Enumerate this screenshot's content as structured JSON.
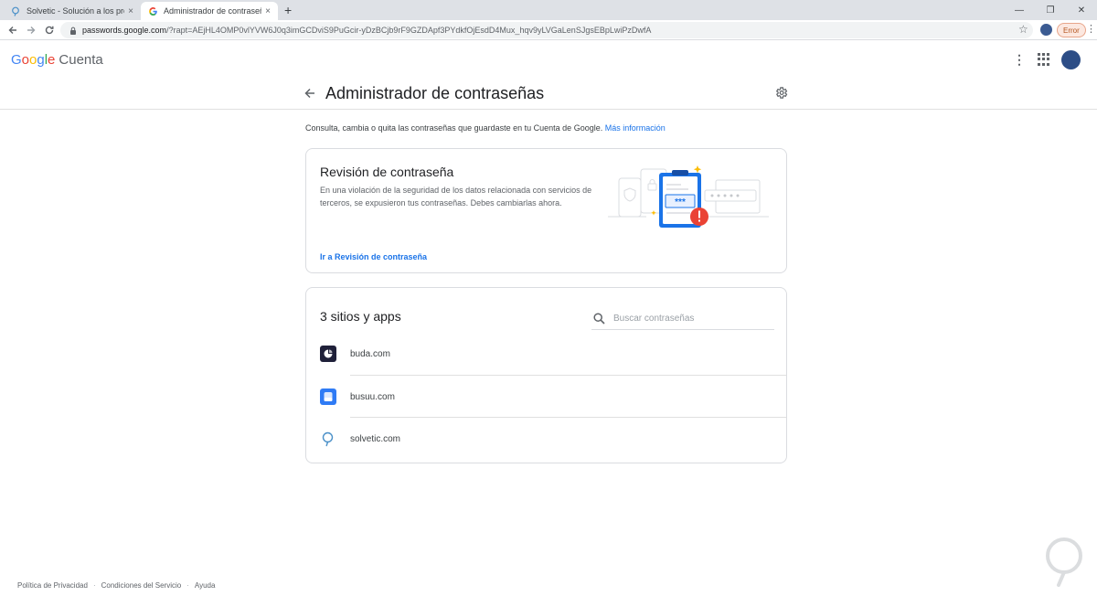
{
  "browser": {
    "tabs": [
      {
        "title": "Solvetic - Solución a los problem",
        "close": "×",
        "active": false
      },
      {
        "title": "Administrador de contraseñas",
        "close": "×",
        "active": true
      }
    ],
    "new_tab": "+",
    "window_controls": [
      "—",
      "❐",
      "✕"
    ],
    "url_host": "passwords.google.com",
    "url_path": "/?rapt=AEjHL4OMP0vlYVW6J0q3imGCDviS9PuGcir-yDzBCjb9rF9GZDApf3PYdkfOjEsdD4Mux_hqv9yLVGaLenSJgsEBpLwiPzDwfA",
    "error_label": "Error"
  },
  "header": {
    "logo_letters": [
      "G",
      "o",
      "o",
      "g",
      "l",
      "e"
    ],
    "product": "Cuenta"
  },
  "page": {
    "title": "Administrador de contraseñas",
    "intro_text": "Consulta, cambia o quita las contraseñas que guardaste en tu Cuenta de Google.",
    "intro_link": "Más información"
  },
  "checkup": {
    "title": "Revisión de contraseña",
    "description": "En una violación de la seguridad de los datos relacionada con servicios de terceros, se expusieron tus contraseñas. Debes cambiarlas ahora.",
    "link": "Ir a Revisión de contraseña",
    "illustration_mask": "***"
  },
  "sites": {
    "title": "3 sitios y apps",
    "search_placeholder": "Buscar contraseñas",
    "items": [
      {
        "name": "buda.com"
      },
      {
        "name": "busuu.com"
      },
      {
        "name": "solvetic.com"
      }
    ]
  },
  "footer": {
    "links": [
      "Política de Privacidad",
      "Condiciones del Servicio",
      "Ayuda"
    ],
    "separator": "·"
  },
  "colors": {
    "accent_blue": "#1a73e8",
    "alert_red": "#ea4335",
    "clipboard_blue": "#1a73e8"
  }
}
